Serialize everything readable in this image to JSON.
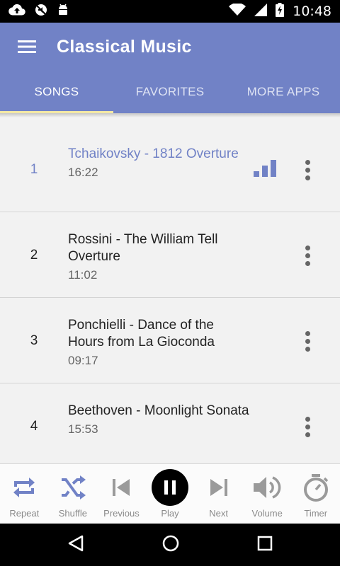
{
  "status_bar": {
    "time": "10:48",
    "icons": [
      "cloud-upload-icon",
      "mute-icon",
      "android-icon",
      "wifi-icon",
      "signal-icon",
      "battery-charging-icon"
    ]
  },
  "app_bar": {
    "title": "Classical Music",
    "menu_icon": "hamburger-menu-icon"
  },
  "tabs": [
    {
      "label": "SONGS",
      "active": true
    },
    {
      "label": "FAVORITES",
      "active": false
    },
    {
      "label": "MORE APPS",
      "active": false
    }
  ],
  "songs": [
    {
      "number": "1",
      "title": "Tchaikovsky - 1812 Overture",
      "duration": "16:22",
      "playing": true
    },
    {
      "number": "2",
      "title": "Rossini - The William Tell Overture",
      "duration": "11:02",
      "playing": false
    },
    {
      "number": "3",
      "title": "Ponchielli - Dance of the Hours from La Gioconda",
      "duration": "09:17",
      "playing": false
    },
    {
      "number": "4",
      "title": "Beethoven - Moonlight Sonata",
      "duration": "15:53",
      "playing": false
    }
  ],
  "controls": {
    "repeat": "Repeat",
    "shuffle": "Shuffle",
    "previous": "Previous",
    "play": "Play",
    "next": "Next",
    "volume": "Volume",
    "timer": "Timer"
  },
  "colors": {
    "primary": "#7182c6",
    "indicator": "#f4e9a4",
    "control_icon": "#7182c6",
    "control_icon_inactive": "#9a9a9a"
  }
}
